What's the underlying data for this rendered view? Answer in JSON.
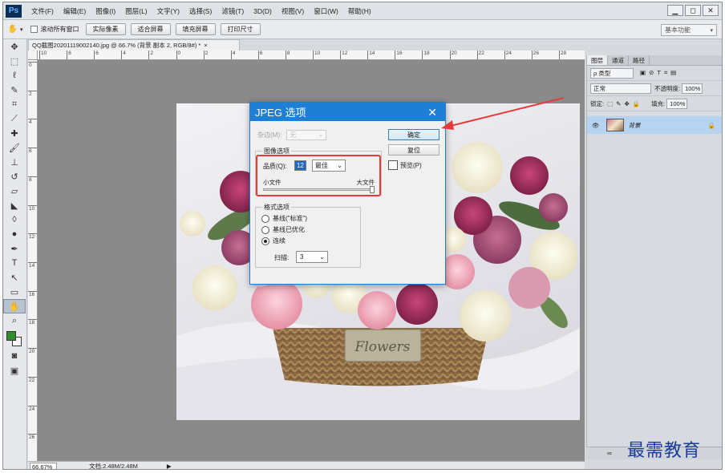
{
  "menubar": {
    "logo": "Ps",
    "items": [
      "文件(F)",
      "编辑(E)",
      "图像(I)",
      "图层(L)",
      "文字(Y)",
      "选择(S)",
      "滤镜(T)",
      "3D(D)",
      "视图(V)",
      "窗口(W)",
      "帮助(H)"
    ]
  },
  "window_controls": {
    "minimize": "▁",
    "restore": "◻",
    "close": "✕"
  },
  "options_bar": {
    "scroll_all_label": "滚动所有窗口",
    "buttons": [
      "实际像素",
      "适合屏幕",
      "填充屏幕",
      "打印尺寸"
    ],
    "workspace": "基本功能"
  },
  "document": {
    "tab_title": "QQ截图20201119002140.jpg @ 66.7% (背景 副本 2, RGB/8#) *",
    "ruler_h": [
      "10",
      "8",
      "6",
      "4",
      "2",
      "0",
      "2",
      "4",
      "6",
      "8",
      "10",
      "12",
      "14",
      "16",
      "18",
      "20",
      "22",
      "24",
      "26",
      "28"
    ],
    "ruler_v": [
      "0",
      "2",
      "4",
      "6",
      "8",
      "10",
      "12",
      "14",
      "16",
      "18",
      "20",
      "22",
      "24",
      "26"
    ],
    "photo_text": "Flowers"
  },
  "status": {
    "zoom": "66.67%",
    "doc_size": "文档:2.48M/2.48M"
  },
  "layers_panel": {
    "tabs": [
      "图层",
      "通道",
      "路径"
    ],
    "filter": "ρ 类型",
    "blend_mode": "正常",
    "opacity_label": "不透明度:",
    "opacity_value": "100%",
    "lock_label": "锁定:",
    "fill_label": "填充:",
    "fill_value": "100%",
    "layer_name": "背景",
    "bottom_icons": "∞"
  },
  "jpeg_dialog": {
    "title": "JPEG 选项",
    "matte_label": "杂边(M):",
    "matte_value": "无",
    "image_options_legend": "图像选项",
    "quality_label": "品质(Q):",
    "quality_value": "12",
    "quality_preset": "最佳",
    "small_file": "小文件",
    "large_file": "大文件",
    "format_options_legend": "格式选项",
    "format_baseline_standard": "基线(\"标准\")",
    "format_baseline_optimized": "基线已优化",
    "format_progressive": "连续",
    "scans_label": "扫描:",
    "scans_value": "3",
    "ok_label": "确定",
    "reset_label": "复位",
    "preview_label": "预览(P)"
  },
  "watermark": "最需教育",
  "colors": {
    "dialog_title_bar": "#1d7fd6",
    "highlight_box": "#e53b3b",
    "arrow": "#e53b3b",
    "foreground_swatch": "#2f8d2b",
    "watermark": "#1a3a9c"
  }
}
